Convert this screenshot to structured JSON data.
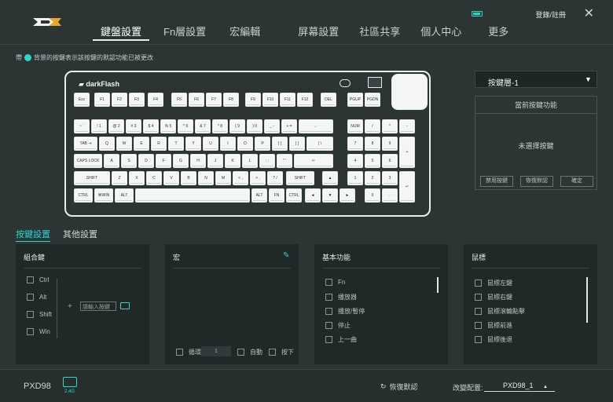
{
  "header": {
    "nav": [
      "鍵盤設置",
      "Fn層設置",
      "宏編輯",
      "屏幕設置",
      "社區共享",
      "個人中心",
      "更多"
    ],
    "login": "登錄/註冊",
    "close": "✕"
  },
  "hint": "背景的按鍵表示該按鍵的默認功能已被更改",
  "hint_prefix": "帶",
  "keyboard": {
    "brand": "darkFlash",
    "rows": {
      "fn": [
        "Esc",
        "F1",
        "F2",
        "F3",
        "F4",
        "F5",
        "F6",
        "F7",
        "F8",
        "F9",
        "F10",
        "F11",
        "F12",
        "DEL",
        "PGUP",
        "PGDN"
      ],
      "num": [
        "~ `",
        "! 1",
        "@ 2",
        "# 3",
        "$ 4",
        "% 5",
        "^ 6",
        "& 7",
        "* 8",
        "( 9",
        ") 0",
        "_ -",
        "+ =",
        "←",
        "NUM",
        "/",
        "*",
        "-"
      ],
      "tab": [
        "TAB ⇥",
        "Q",
        "W",
        "E",
        "R",
        "T",
        "Y",
        "U",
        "I",
        "O",
        "P",
        "{ [",
        "} ]",
        "| \\",
        "7",
        "8",
        "9",
        "+"
      ],
      "caps": [
        "CAPS LOCK",
        "A",
        "S",
        "D",
        "F",
        "G",
        "H",
        "J",
        "K",
        "L",
        ": ;",
        "\" '",
        "↵",
        "4",
        "5",
        "6"
      ],
      "shift": [
        "SHIFT",
        "Z",
        "X",
        "C",
        "V",
        "B",
        "N",
        "M",
        "< ,",
        "> .",
        "? /",
        "SHIFT",
        "▲",
        "1",
        "2",
        "3",
        "↵"
      ],
      "ctrl": [
        "CTRL",
        "⌘WIN",
        "ALT",
        "",
        "ALT",
        "FN",
        "CTRL",
        "◄",
        "▼",
        "►",
        "0",
        "."
      ]
    }
  },
  "layer": {
    "selected": "按鍵層-1",
    "caret": "▼"
  },
  "current": {
    "title": "當前按鍵功能",
    "empty": "未選擇按鍵",
    "buttons": [
      "禁用按鍵",
      "恢復默認",
      "確定"
    ]
  },
  "tabs": [
    "按鍵設置",
    "其他設置"
  ],
  "combo": {
    "title": "組合鍵",
    "items": [
      "Ctrl",
      "Alt",
      "Shift",
      "Win"
    ],
    "plus": "+",
    "input_placeholder": "請輸入按鍵"
  },
  "macro": {
    "title": "宏",
    "loop": "循環",
    "count": "1",
    "auto": "自動",
    "press": "按下"
  },
  "basic": {
    "title": "基本功能",
    "items": [
      "Fn",
      "播放器",
      "播放/暫停",
      "停止",
      "上一曲"
    ]
  },
  "mouse": {
    "title": "鼠標",
    "items": [
      "鼠標左鍵",
      "鼠標右鍵",
      "鼠標滾輪點擊",
      "鼠標前進",
      "鼠標後退"
    ]
  },
  "footer": {
    "model": "PXD98",
    "dongle": "2.4G",
    "reset": "恢復默認",
    "cfg_label": "改變配置:",
    "cfg_value": "PXD98_1",
    "cfg_caret": "▲"
  }
}
